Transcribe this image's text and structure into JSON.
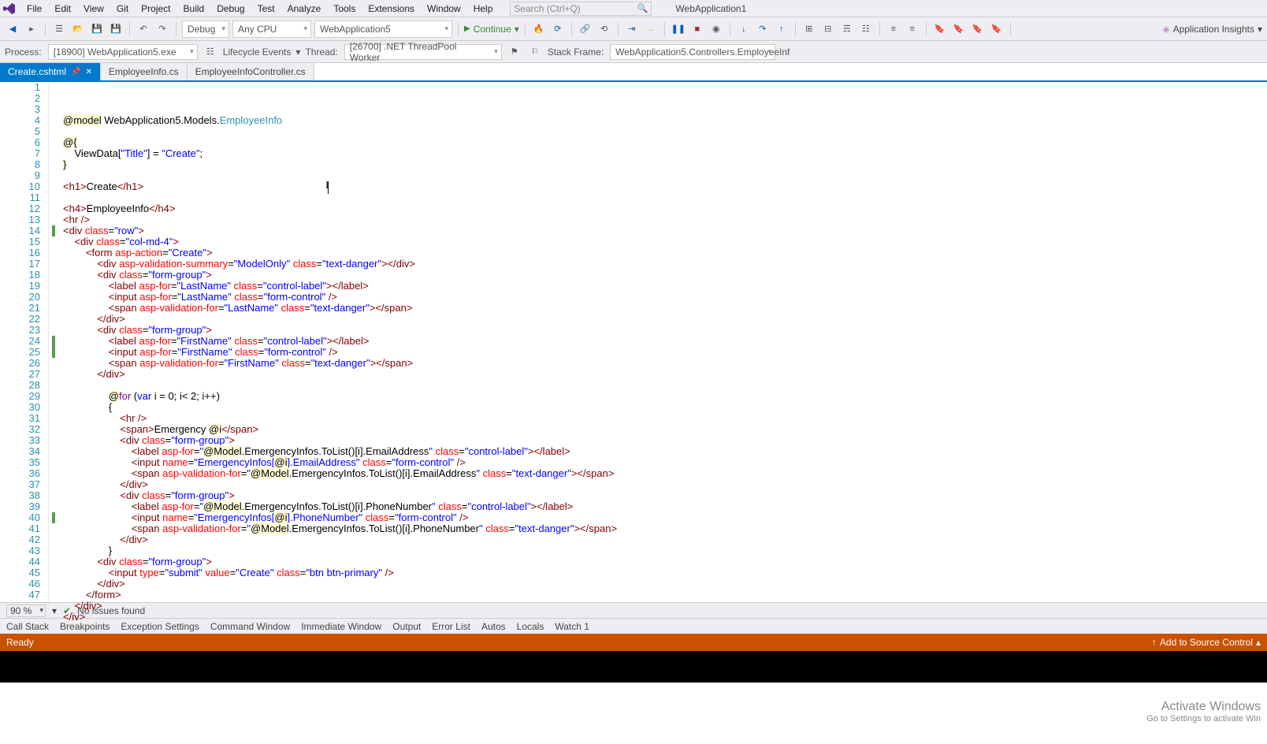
{
  "menu": {
    "items": [
      "File",
      "Edit",
      "View",
      "Git",
      "Project",
      "Build",
      "Debug",
      "Test",
      "Analyze",
      "Tools",
      "Extensions",
      "Window",
      "Help"
    ],
    "search_placeholder": "Search (Ctrl+Q)",
    "project": "WebApplication1"
  },
  "tb": {
    "config": "Debug",
    "platform": "Any CPU",
    "startup": "WebApplication5",
    "continue": "Continue",
    "ai": "Application Insights"
  },
  "tb2": {
    "process_lbl": "Process:",
    "process": "[18900] WebApplication5.exe",
    "lifecycle": "Lifecycle Events",
    "thread_lbl": "Thread:",
    "thread": "[26700] .NET ThreadPool Worker",
    "stack_lbl": "Stack Frame:",
    "stack": "WebApplication5.Controllers.EmployeeInf"
  },
  "tabs": [
    {
      "label": "Create.cshtml",
      "active": true
    },
    {
      "label": "EmployeeInfo.cs",
      "active": false
    },
    {
      "label": "EmployeeInfoController.cs",
      "active": false
    }
  ],
  "zoom": "90 %",
  "issues": "No issues found",
  "panes": [
    "Call Stack",
    "Breakpoints",
    "Exception Settings",
    "Command Window",
    "Immediate Window",
    "Output",
    "Error List",
    "Autos",
    "Locals",
    "Watch 1"
  ],
  "status": {
    "ready": "Ready",
    "srcctl": "Add to Source Control"
  },
  "watermark": {
    "title": "Activate Windows",
    "sub": "Go to Settings to activate Win"
  },
  "code": [
    {
      "n": 1,
      "mod": "",
      "html": "<span class='razor'>@model</span> WebApplication5.Models.<span class='type'>EmployeeInfo</span>"
    },
    {
      "n": 2,
      "mod": "",
      "html": ""
    },
    {
      "n": 3,
      "mod": "",
      "html": "<span class='razor'>@{</span>"
    },
    {
      "n": 4,
      "mod": "",
      "html": "    ViewData[<span class='str'>\"Title\"</span>] = <span class='str'>\"Create\"</span>;"
    },
    {
      "n": 5,
      "mod": "",
      "html": "<span class='razor'>}</span>"
    },
    {
      "n": 6,
      "mod": "",
      "html": ""
    },
    {
      "n": 7,
      "mod": "",
      "html": "<span class='tag'>&lt;h1&gt;</span>Create<span class='tag'>&lt;/h1&gt;</span>"
    },
    {
      "n": 8,
      "mod": "",
      "html": ""
    },
    {
      "n": 9,
      "mod": "",
      "html": "<span class='tag'>&lt;h4&gt;</span>EmployeeInfo<span class='tag'>&lt;/h4&gt;</span>"
    },
    {
      "n": 10,
      "mod": "",
      "html": "<span class='tag'>&lt;hr</span> <span class='tag'>/&gt;</span>"
    },
    {
      "n": 11,
      "mod": "",
      "html": "<span class='tag'>&lt;div</span> <span class='attr'>class</span>=<span class='str'>\"row\"</span><span class='tag'>&gt;</span>"
    },
    {
      "n": 12,
      "mod": "",
      "html": "    <span class='tag'>&lt;div</span> <span class='attr'>class</span>=<span class='str'>\"col-md-4\"</span><span class='tag'>&gt;</span>"
    },
    {
      "n": 13,
      "mod": "",
      "html": "        <span class='tag'>&lt;form</span> <span class='attr'>asp-action</span>=<span class='str'>\"Create\"</span><span class='tag'>&gt;</span>"
    },
    {
      "n": 14,
      "mod": "g",
      "html": "            <span class='tag'>&lt;div</span> <span class='attr'>asp-validation-summary</span>=<span class='str'>\"ModelOnly\"</span> <span class='attr'>class</span>=<span class='str'>\"text-danger\"</span><span class='tag'>&gt;&lt;/div&gt;</span>"
    },
    {
      "n": 15,
      "mod": "",
      "html": "            <span class='tag'>&lt;div</span> <span class='attr'>class</span>=<span class='str'>\"form-group\"</span><span class='tag'>&gt;</span>"
    },
    {
      "n": 16,
      "mod": "",
      "html": "                <span class='tag'>&lt;label</span> <span class='attr'>asp-for</span>=<span class='str'>\"LastName\"</span> <span class='attr'>class</span>=<span class='str'>\"control-label\"</span><span class='tag'>&gt;&lt;/label&gt;</span>"
    },
    {
      "n": 17,
      "mod": "",
      "html": "                <span class='tag'>&lt;input</span> <span class='attr'>asp-for</span>=<span class='str'>\"LastName\"</span> <span class='attr'>class</span>=<span class='str'>\"form-control\"</span> <span class='tag'>/&gt;</span>"
    },
    {
      "n": 18,
      "mod": "",
      "html": "                <span class='tag'>&lt;span</span> <span class='attr'>asp-validation-for</span>=<span class='str'>\"LastName\"</span> <span class='attr'>class</span>=<span class='str'>\"text-danger\"</span><span class='tag'>&gt;&lt;/span&gt;</span>"
    },
    {
      "n": 19,
      "mod": "",
      "html": "            <span class='tag'>&lt;/div&gt;</span>"
    },
    {
      "n": 20,
      "mod": "",
      "html": "            <span class='tag'>&lt;div</span> <span class='attr'>class</span>=<span class='str'>\"form-group\"</span><span class='tag'>&gt;</span>"
    },
    {
      "n": 21,
      "mod": "",
      "html": "                <span class='tag'>&lt;label</span> <span class='attr'>asp-for</span>=<span class='str'>\"FirstName\"</span> <span class='attr'>class</span>=<span class='str'>\"control-label\"</span><span class='tag'>&gt;&lt;/label&gt;</span>"
    },
    {
      "n": 22,
      "mod": "",
      "html": "                <span class='tag'>&lt;input</span> <span class='attr'>asp-for</span>=<span class='str'>\"FirstName\"</span> <span class='attr'>class</span>=<span class='str'>\"form-control\"</span> <span class='tag'>/&gt;</span>"
    },
    {
      "n": 23,
      "mod": "",
      "html": "                <span class='tag'>&lt;span</span> <span class='attr'>asp-validation-for</span>=<span class='str'>\"FirstName\"</span> <span class='attr'>class</span>=<span class='str'>\"text-danger\"</span><span class='tag'>&gt;&lt;/span&gt;</span>"
    },
    {
      "n": 24,
      "mod": "g",
      "html": "            <span class='tag'>&lt;/div&gt;</span>"
    },
    {
      "n": 25,
      "mod": "g",
      "html": ""
    },
    {
      "n": 26,
      "mod": "",
      "html": "                <span class='razor'>@</span><span class='razorkw'>for</span> (<span class='kw'>var</span> i = 0; i&lt; 2; i++)"
    },
    {
      "n": 27,
      "mod": "",
      "html": "                {"
    },
    {
      "n": 28,
      "mod": "",
      "html": "                    <span class='tag'>&lt;hr</span> <span class='tag'>/&gt;</span>"
    },
    {
      "n": 29,
      "mod": "",
      "html": "                    <span class='tag'>&lt;span&gt;</span>Emergency <span class='razor'>@i</span><span class='tag'>&lt;/span&gt;</span>"
    },
    {
      "n": 30,
      "mod": "",
      "html": "                    <span class='tag'>&lt;div</span> <span class='attr'>class</span>=<span class='str'>\"form-group\"</span><span class='tag'>&gt;</span>"
    },
    {
      "n": 31,
      "mod": "",
      "html": "                        <span class='tag'>&lt;label</span> <span class='attr'>asp-for</span>=<span class='str'>\"</span><span class='razor'>@Model</span>.EmergencyInfos.ToList()[i].EmailAddress<span class='str'>\"</span> <span class='attr'>class</span>=<span class='str'>\"control-label\"</span><span class='tag'>&gt;&lt;/label&gt;</span>"
    },
    {
      "n": 32,
      "mod": "",
      "html": "                        <span class='tag'>&lt;input</span> <span class='attr'>name</span>=<span class='str'>\"EmergencyInfos[</span><span class='razor'>@i</span><span class='str'>].EmailAddress\"</span> <span class='attr'>class</span>=<span class='str'>\"form-control\"</span> <span class='tag'>/&gt;</span>"
    },
    {
      "n": 33,
      "mod": "",
      "html": "                        <span class='tag'>&lt;span</span> <span class='attr'>asp-validation-for</span>=<span class='str'>\"</span><span class='razor'>@Model</span>.EmergencyInfos.ToList()[i].EmailAddress<span class='str'>\"</span> <span class='attr'>class</span>=<span class='str'>\"text-danger\"</span><span class='tag'>&gt;&lt;/span&gt;</span>"
    },
    {
      "n": 34,
      "mod": "",
      "html": "                    <span class='tag'>&lt;/div&gt;</span>"
    },
    {
      "n": 35,
      "mod": "",
      "html": "                    <span class='tag'>&lt;div</span> <span class='attr'>class</span>=<span class='str'>\"form-group\"</span><span class='tag'>&gt;</span>"
    },
    {
      "n": 36,
      "mod": "",
      "html": "                        <span class='tag'>&lt;label</span> <span class='attr'>asp-for</span>=<span class='str'>\"</span><span class='razor'>@Model</span>.EmergencyInfos.ToList()[i].PhoneNumber<span class='str'>\"</span> <span class='attr'>class</span>=<span class='str'>\"control-label\"</span><span class='tag'>&gt;&lt;/label&gt;</span>"
    },
    {
      "n": 37,
      "mod": "",
      "html": "                        <span class='tag'>&lt;input</span> <span class='attr'>name</span>=<span class='str'>\"EmergencyInfos[</span><span class='razor'>@i</span><span class='str'>].PhoneNumber\"</span> <span class='attr'>class</span>=<span class='str'>\"form-control\"</span> <span class='tag'>/&gt;</span>"
    },
    {
      "n": 38,
      "mod": "",
      "html": "                        <span class='tag'>&lt;span</span> <span class='attr'>asp-validation-for</span>=<span class='str'>\"</span><span class='razor'>@Model</span>.EmergencyInfos.ToList()[i].PhoneNumber<span class='str'>\"</span> <span class='attr'>class</span>=<span class='str'>\"text-danger\"</span><span class='tag'>&gt;&lt;/span&gt;</span>"
    },
    {
      "n": 39,
      "mod": "",
      "html": "                    <span class='tag'>&lt;/div&gt;</span>"
    },
    {
      "n": 40,
      "mod": "g",
      "html": "                }"
    },
    {
      "n": 41,
      "mod": "",
      "html": "            <span class='tag'>&lt;div</span> <span class='attr'>class</span>=<span class='str'>\"form-group\"</span><span class='tag'>&gt;</span>"
    },
    {
      "n": 42,
      "mod": "",
      "html": "                <span class='tag'>&lt;input</span> <span class='attr'>type</span>=<span class='str'>\"submit\"</span> <span class='attr'>value</span>=<span class='str'>\"Create\"</span> <span class='attr'>class</span>=<span class='str'>\"btn btn-primary\"</span> <span class='tag'>/&gt;</span>"
    },
    {
      "n": 43,
      "mod": "",
      "html": "            <span class='tag'>&lt;/div&gt;</span>"
    },
    {
      "n": 44,
      "mod": "",
      "html": "        <span class='tag'>&lt;/form&gt;</span>"
    },
    {
      "n": 45,
      "mod": "",
      "html": "    <span class='tag'>&lt;/div&gt;</span>"
    },
    {
      "n": 46,
      "mod": "",
      "html": "<span class='tag'>&lt;/iv&gt;</span>"
    },
    {
      "n": 47,
      "mod": "",
      "html": ""
    }
  ]
}
